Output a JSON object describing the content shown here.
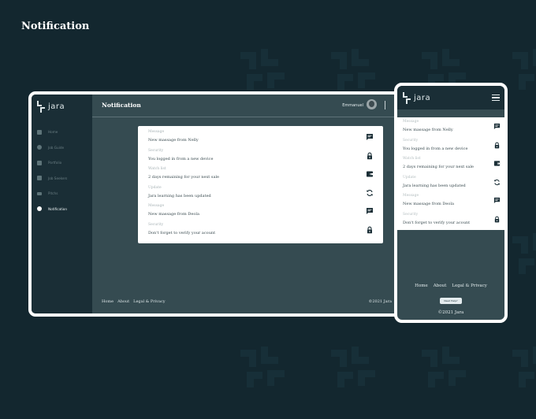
{
  "page": {
    "title": "Notification"
  },
  "brand": {
    "name": "jara"
  },
  "desktop": {
    "sidebar": {
      "items": [
        {
          "label": "Home",
          "icon": "home-icon",
          "active": false
        },
        {
          "label": "Job Guide",
          "icon": "guide-icon",
          "active": false
        },
        {
          "label": "Portfolio",
          "icon": "portfolio-icon",
          "active": false
        },
        {
          "label": "Job Seekers",
          "icon": "seekers-icon",
          "active": false
        },
        {
          "label": "Pitchs",
          "icon": "pitch-icon",
          "active": false
        },
        {
          "label": "Notification",
          "icon": "notification-icon",
          "active": true
        }
      ]
    },
    "header": {
      "title": "Notification",
      "user": "Emmanuel"
    },
    "footer": {
      "links": [
        "Home",
        "About",
        "Legal & Privacy"
      ],
      "copyright": "©2021 Jara"
    }
  },
  "notifications": [
    {
      "category": "Message",
      "text": "New massage from Nelly",
      "icon": "message-icon"
    },
    {
      "category": "Security",
      "text": "You logged in from a new device",
      "icon": "lock-icon"
    },
    {
      "category": "Watch list",
      "text": "2 days remaining for your next sale",
      "icon": "wallet-icon"
    },
    {
      "category": "Update",
      "text": "Jara learning has been updated",
      "icon": "sync-icon"
    },
    {
      "category": "Message",
      "text": "New massage from Deola",
      "icon": "message-icon"
    },
    {
      "category": "Security",
      "text": "Don't forget to verify your acount",
      "icon": "lock-icon"
    }
  ],
  "mobile": {
    "footer": {
      "links": [
        "Home",
        "About",
        "Legal & Privacy"
      ],
      "help": "Need Help?",
      "copyright": "©2021 Jara"
    }
  },
  "colors": {
    "background": "#13272f",
    "sidebar": "#1a2e36",
    "panel": "#354b51",
    "card": "#ffffff",
    "icon": "#1a2e36"
  }
}
